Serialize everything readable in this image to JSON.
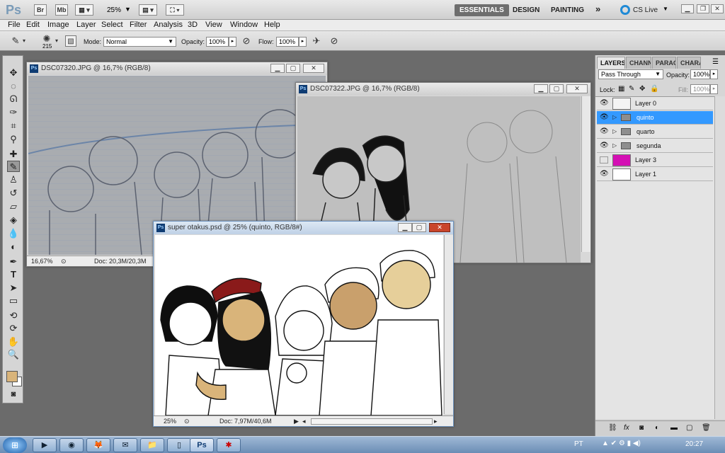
{
  "appbar": {
    "logo": "Ps",
    "br_label": "Br",
    "mb_label": "Mb",
    "zoom": "25%",
    "workspaces": [
      "ESSENTIALS",
      "DESIGN",
      "PAINTING"
    ],
    "active_workspace": "ESSENTIALS",
    "more": "»",
    "cslive": "CS Live"
  },
  "menu": [
    "File",
    "Edit",
    "Image",
    "Layer",
    "Select",
    "Filter",
    "Analysis",
    "3D",
    "View",
    "Window",
    "Help"
  ],
  "options": {
    "brush_size": "215",
    "mode_label": "Mode:",
    "mode_value": "Normal",
    "opacity_label": "Opacity:",
    "opacity_value": "100%",
    "flow_label": "Flow:",
    "flow_value": "100%"
  },
  "windows": [
    {
      "title": "DSC07320.JPG @ 16,7% (RGB/8)",
      "zoom": "16,67%",
      "doc": "Doc: 20,3M/20,3M"
    },
    {
      "title": "DSC07322.JPG @ 16,7% (RGB/8)"
    },
    {
      "title": "super otakus.psd @ 25% (quinto, RGB/8#)",
      "zoom": "25%",
      "doc": "Doc: 7,97M/40,6M"
    }
  ],
  "panel": {
    "tabs": [
      "LAYERS",
      "CHANN",
      "PARAGI",
      "CHARA("
    ],
    "blend_mode": "Pass Through",
    "opacity_label": "Opacity:",
    "opacity_value": "100%",
    "lock_label": "Lock:",
    "fill_label": "Fill:",
    "fill_value": "100%",
    "layers": [
      {
        "name": "Layer 0",
        "visible": true,
        "type": "layer",
        "thumb": "#f4f4f4"
      },
      {
        "name": "quinto",
        "visible": true,
        "type": "group",
        "selected": true
      },
      {
        "name": "quarto",
        "visible": true,
        "type": "group"
      },
      {
        "name": "segunda",
        "visible": true,
        "type": "group"
      },
      {
        "name": "Layer 3",
        "visible": false,
        "type": "layer",
        "thumb": "#d410b4"
      },
      {
        "name": "Layer 1",
        "visible": true,
        "type": "layer",
        "thumb": "#ffffff"
      }
    ]
  },
  "colors": {
    "foreground": "#d9b47a",
    "background": "#ffffff",
    "selection": "#3399ff"
  },
  "taskbar": {
    "lang": "PT",
    "time": "20:27"
  }
}
